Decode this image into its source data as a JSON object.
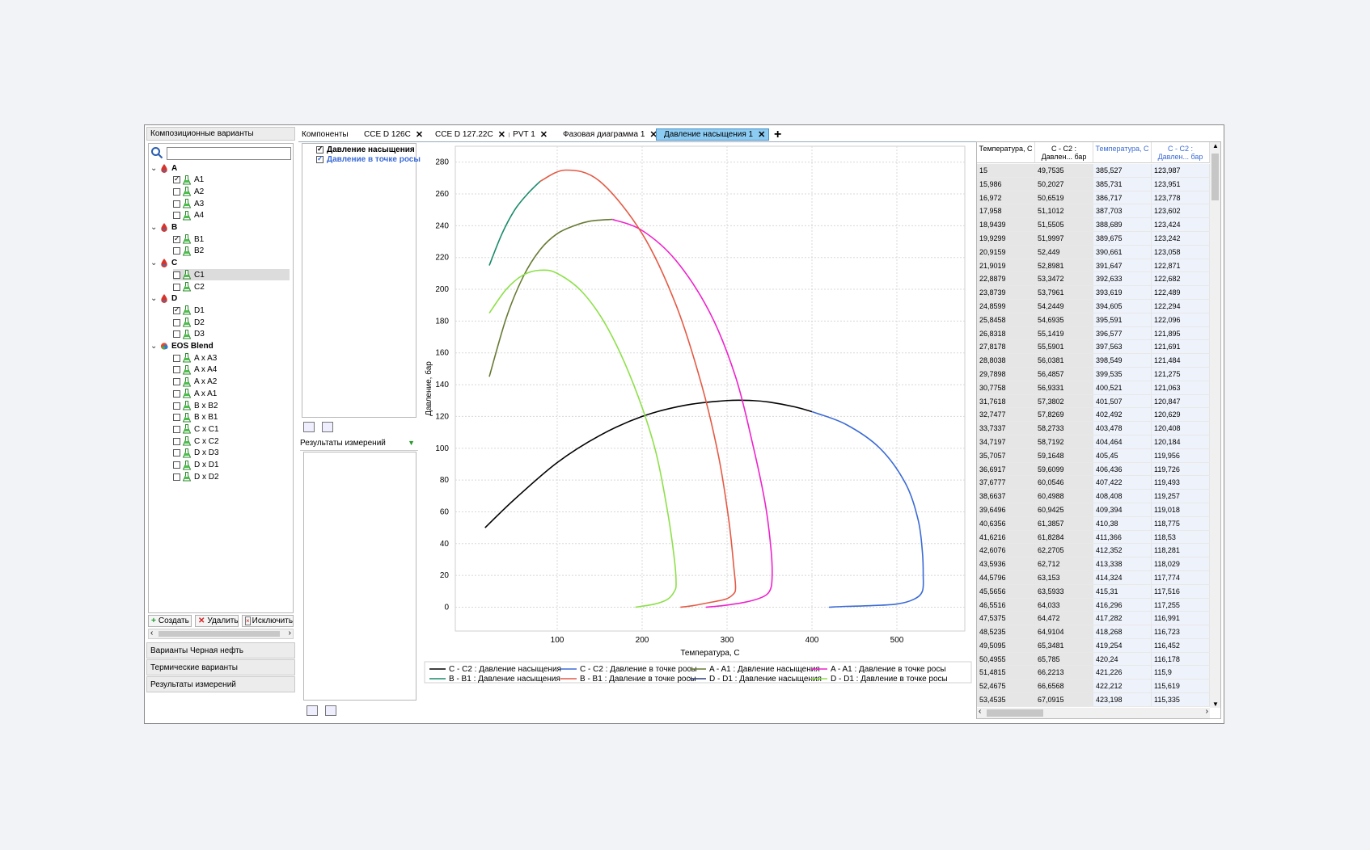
{
  "left_panel": {
    "header": "Композиционные варианты",
    "tree": [
      {
        "label": "A",
        "type": "group",
        "expanded": true
      },
      {
        "label": "A1",
        "type": "item",
        "checked": true
      },
      {
        "label": "A2",
        "type": "item",
        "checked": false
      },
      {
        "label": "A3",
        "type": "item",
        "checked": false
      },
      {
        "label": "A4",
        "type": "item",
        "checked": false
      },
      {
        "label": "B",
        "type": "group",
        "expanded": true
      },
      {
        "label": "B1",
        "type": "item",
        "checked": true
      },
      {
        "label": "B2",
        "type": "item",
        "checked": false
      },
      {
        "label": "C",
        "type": "group",
        "expanded": true
      },
      {
        "label": "C1",
        "type": "item",
        "checked": false,
        "selected": true
      },
      {
        "label": "C2",
        "type": "item",
        "checked": false
      },
      {
        "label": "D",
        "type": "group",
        "expanded": true
      },
      {
        "label": "D1",
        "type": "item",
        "checked": true
      },
      {
        "label": "D2",
        "type": "item",
        "checked": false
      },
      {
        "label": "D3",
        "type": "item",
        "checked": false
      },
      {
        "label": "EOS Blend",
        "type": "group",
        "expanded": true,
        "blend": true
      },
      {
        "label": "A x A3",
        "type": "item",
        "checked": false
      },
      {
        "label": "A x A4",
        "type": "item",
        "checked": false
      },
      {
        "label": "A x A2",
        "type": "item",
        "checked": false
      },
      {
        "label": "A x A1",
        "type": "item",
        "checked": false
      },
      {
        "label": "B x B2",
        "type": "item",
        "checked": false
      },
      {
        "label": "B x B1",
        "type": "item",
        "checked": false
      },
      {
        "label": "C x C1",
        "type": "item",
        "checked": false
      },
      {
        "label": "C x C2",
        "type": "item",
        "checked": false
      },
      {
        "label": "D x D3",
        "type": "item",
        "checked": false
      },
      {
        "label": "D x D1",
        "type": "item",
        "checked": false
      },
      {
        "label": "D x D2",
        "type": "item",
        "checked": false
      }
    ],
    "buttons": {
      "create": "Создать",
      "delete": "Удалить",
      "exclude": "Исключить"
    },
    "sections": [
      "Варианты Черная нефть",
      "Термические варианты",
      "Результаты измерений"
    ]
  },
  "tabs": [
    {
      "label": "Компоненты",
      "dot": null
    },
    {
      "label": "CCE D 126C",
      "dot": "#2eaa55"
    },
    {
      "label": "CCE D 127.22C",
      "dot": "#999999"
    },
    {
      "label": "PVT 1",
      "dot": "#999999"
    },
    {
      "label": "Фазовая диаграмма 1",
      "dot": "#999999"
    },
    {
      "label": "Давление насыщения 1",
      "dot": "#999999",
      "active": true
    }
  ],
  "middle": {
    "checks": [
      {
        "label": "Давление насыщения",
        "color": "#000000",
        "checked": true
      },
      {
        "label": "Давление в точке росы",
        "color": "#3b6bd6",
        "checked": true
      }
    ],
    "measurements_label": "Результаты измерений"
  },
  "chart_data": {
    "type": "line",
    "xlabel": "Температура, С",
    "ylabel": "Давление, бар",
    "xlim": [
      -20,
      580
    ],
    "ylim": [
      -15,
      290
    ],
    "xticks": [
      100,
      200,
      300,
      400,
      500
    ],
    "yticks": [
      0,
      20,
      40,
      60,
      80,
      100,
      120,
      140,
      160,
      180,
      200,
      220,
      240,
      260,
      280
    ],
    "grid": true,
    "legend_position": "bottom",
    "series": [
      {
        "name": "C - C2 : Давление насыщения",
        "color": "#000000",
        "x": [
          15,
          50,
          100,
          150,
          200,
          250,
          300,
          330,
          350,
          380,
          400
        ],
        "y": [
          50,
          68,
          91,
          108,
          120,
          127,
          130,
          130,
          129,
          126,
          123
        ]
      },
      {
        "name": "C - C2 : Давление в точке росы",
        "color": "#3b6bd6",
        "x": [
          400,
          440,
          480,
          510,
          525,
          530,
          531,
          530,
          520,
          500,
          470,
          440,
          420
        ],
        "y": [
          123,
          115,
          100,
          78,
          55,
          35,
          20,
          10,
          5,
          2,
          1,
          0.5,
          0
        ]
      },
      {
        "name": "A - A1 : Давление насыщения",
        "color": "#667a33",
        "x": [
          20,
          40,
          60,
          80,
          100,
          120,
          140,
          165
        ],
        "y": [
          145,
          182,
          208,
          225,
          235,
          240,
          243,
          244
        ]
      },
      {
        "name": "A - A1 : Давление в точке росы",
        "color": "#ee22cc",
        "x": [
          165,
          200,
          240,
          280,
          310,
          330,
          345,
          352,
          353,
          350,
          340,
          320,
          295,
          275
        ],
        "y": [
          244,
          237,
          218,
          185,
          145,
          103,
          65,
          35,
          18,
          10,
          6,
          3,
          1,
          0
        ]
      },
      {
        "name": "B - B1 : Давление насыщения",
        "color": "#1a8a6a",
        "x": [
          20,
          35,
          50,
          65,
          80
        ],
        "y": [
          215,
          235,
          250,
          260,
          268
        ]
      },
      {
        "name": "B - B1 : Давление в точке росы",
        "color": "#e45a45",
        "x": [
          80,
          110,
          150,
          200,
          240,
          270,
          290,
          302,
          308,
          310,
          307,
          298,
          280,
          260,
          245
        ],
        "y": [
          268,
          275,
          268,
          235,
          190,
          140,
          95,
          55,
          25,
          12,
          8,
          5,
          3,
          1,
          0
        ]
      },
      {
        "name": "D - D1 : Давление насыщения",
        "color": "#2c3e78",
        "x": [],
        "y": []
      },
      {
        "name": "D - D1 : Давление в точке росы",
        "color": "#8ee04a",
        "x": [
          20,
          40,
          60,
          80,
          100,
          130,
          160,
          190,
          215,
          230,
          238,
          240,
          238,
          230,
          215,
          192
        ],
        "y": [
          185,
          200,
          209,
          212,
          210,
          198,
          175,
          140,
          100,
          60,
          30,
          15,
          10,
          5,
          2,
          0
        ]
      }
    ]
  },
  "table": {
    "headers": [
      "Температура, С",
      "С - С2 : Давлен... бар",
      "Температура, С",
      "С - С2 : Давлен... бар"
    ],
    "rows": [
      [
        "15",
        "49,7535",
        "385,527",
        "123,987"
      ],
      [
        "15,986",
        "50,2027",
        "385,731",
        "123,951"
      ],
      [
        "16,972",
        "50,6519",
        "386,717",
        "123,778"
      ],
      [
        "17,958",
        "51,1012",
        "387,703",
        "123,602"
      ],
      [
        "18,9439",
        "51,5505",
        "388,689",
        "123,424"
      ],
      [
        "19,9299",
        "51,9997",
        "389,675",
        "123,242"
      ],
      [
        "20,9159",
        "52,449",
        "390,661",
        "123,058"
      ],
      [
        "21,9019",
        "52,8981",
        "391,647",
        "122,871"
      ],
      [
        "22,8879",
        "53,3472",
        "392,633",
        "122,682"
      ],
      [
        "23,8739",
        "53,7961",
        "393,619",
        "122,489"
      ],
      [
        "24,8599",
        "54,2449",
        "394,605",
        "122,294"
      ],
      [
        "25,8458",
        "54,6935",
        "395,591",
        "122,096"
      ],
      [
        "26,8318",
        "55,1419",
        "396,577",
        "121,895"
      ],
      [
        "27,8178",
        "55,5901",
        "397,563",
        "121,691"
      ],
      [
        "28,8038",
        "56,0381",
        "398,549",
        "121,484"
      ],
      [
        "29,7898",
        "56,4857",
        "399,535",
        "121,275"
      ],
      [
        "30,7758",
        "56,9331",
        "400,521",
        "121,063"
      ],
      [
        "31,7618",
        "57,3802",
        "401,507",
        "120,847"
      ],
      [
        "32,7477",
        "57,8269",
        "402,492",
        "120,629"
      ],
      [
        "33,7337",
        "58,2733",
        "403,478",
        "120,408"
      ],
      [
        "34,7197",
        "58,7192",
        "404,464",
        "120,184"
      ],
      [
        "35,7057",
        "59,1648",
        "405,45",
        "119,956"
      ],
      [
        "36,6917",
        "59,6099",
        "406,436",
        "119,726"
      ],
      [
        "37,6777",
        "60,0546",
        "407,422",
        "119,493"
      ],
      [
        "38,6637",
        "60,4988",
        "408,408",
        "119,257"
      ],
      [
        "39,6496",
        "60,9425",
        "409,394",
        "119,018"
      ],
      [
        "40,6356",
        "61,3857",
        "410,38",
        "118,775"
      ],
      [
        "41,6216",
        "61,8284",
        "411,366",
        "118,53"
      ],
      [
        "42,6076",
        "62,2705",
        "412,352",
        "118,281"
      ],
      [
        "43,5936",
        "62,712",
        "413,338",
        "118,029"
      ],
      [
        "44,5796",
        "63,153",
        "414,324",
        "117,774"
      ],
      [
        "45,5656",
        "63,5933",
        "415,31",
        "117,516"
      ],
      [
        "46,5516",
        "64,033",
        "416,296",
        "117,255"
      ],
      [
        "47,5375",
        "64,472",
        "417,282",
        "116,991"
      ],
      [
        "48,5235",
        "64,9104",
        "418,268",
        "116,723"
      ],
      [
        "49,5095",
        "65,3481",
        "419,254",
        "116,452"
      ],
      [
        "50,4955",
        "65,785",
        "420,24",
        "116,178"
      ],
      [
        "51,4815",
        "66,2213",
        "421,226",
        "115,9"
      ],
      [
        "52,4675",
        "66,6568",
        "422,212",
        "115,619"
      ],
      [
        "53,4535",
        "67,0915",
        "423,198",
        "115,335"
      ]
    ]
  }
}
